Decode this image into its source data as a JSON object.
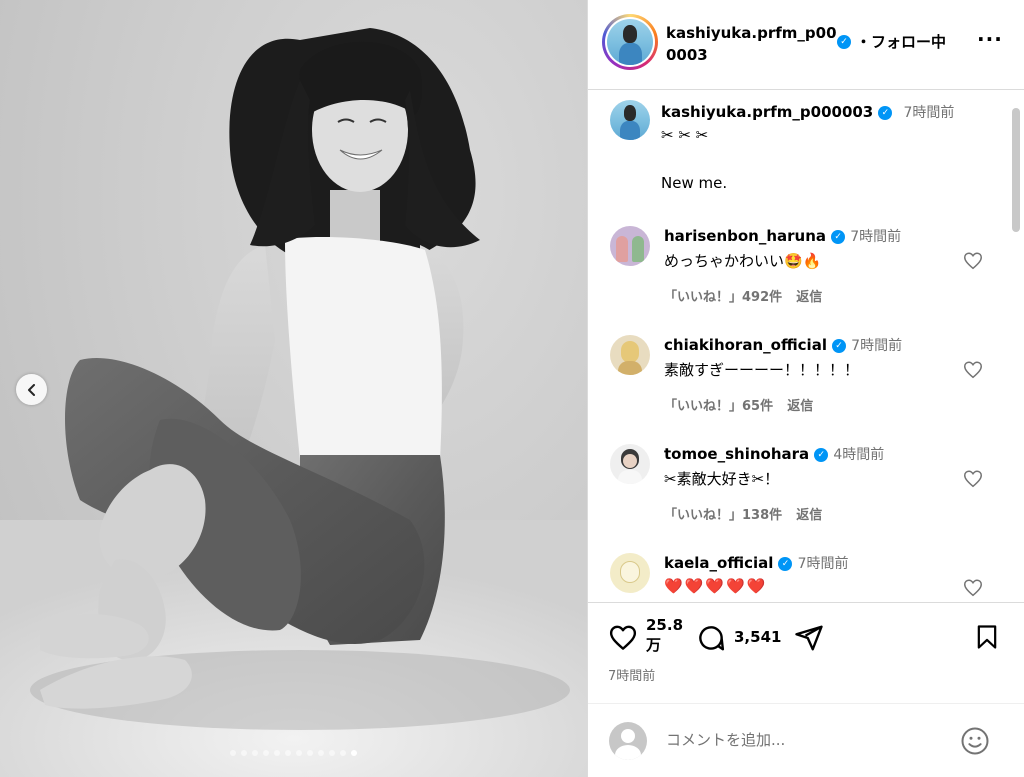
{
  "post": {
    "author": "kashiyuka.prfm_p000003",
    "follow_label": "・フォロー中",
    "more_label": "···",
    "carousel_dots": 12,
    "carousel_active": 11
  },
  "caption": {
    "username": "kashiyuka.prfm_p000003",
    "time": "7時間前",
    "line1": "✂ ✂ ✂",
    "line2": "New me."
  },
  "comments": [
    {
      "username": "harisenbon_haruna",
      "time": "7時間前",
      "text": "めっちゃかわいい🤩🔥",
      "likes": "「いいね！」492件",
      "reply": "返信",
      "avatar": "harisenbon"
    },
    {
      "username": "chiakihoran_official",
      "time": "7時間前",
      "text": "素敵すぎーーーー！！！！！",
      "likes": "「いいね！」65件",
      "reply": "返信",
      "avatar": "chiaki"
    },
    {
      "username": "tomoe_shinohara",
      "time": "4時間前",
      "text": "✂素敵大好き✂！",
      "likes": "「いいね！」138件",
      "reply": "返信",
      "avatar": "tomoe"
    },
    {
      "username": "kaela_official",
      "time": "7時間前",
      "text": "❤️❤️❤️❤️❤️",
      "likes": "",
      "reply": "",
      "avatar": "kaela"
    }
  ],
  "actions": {
    "like_count_line1": "25.8",
    "like_count_line2": "万",
    "comment_count": "3,541",
    "post_time": "7時間前"
  },
  "add_comment": {
    "placeholder": "コメントを追加..."
  },
  "colors": {
    "verified": "#0095f6",
    "border": "#dbdbdb",
    "muted": "#737373"
  }
}
